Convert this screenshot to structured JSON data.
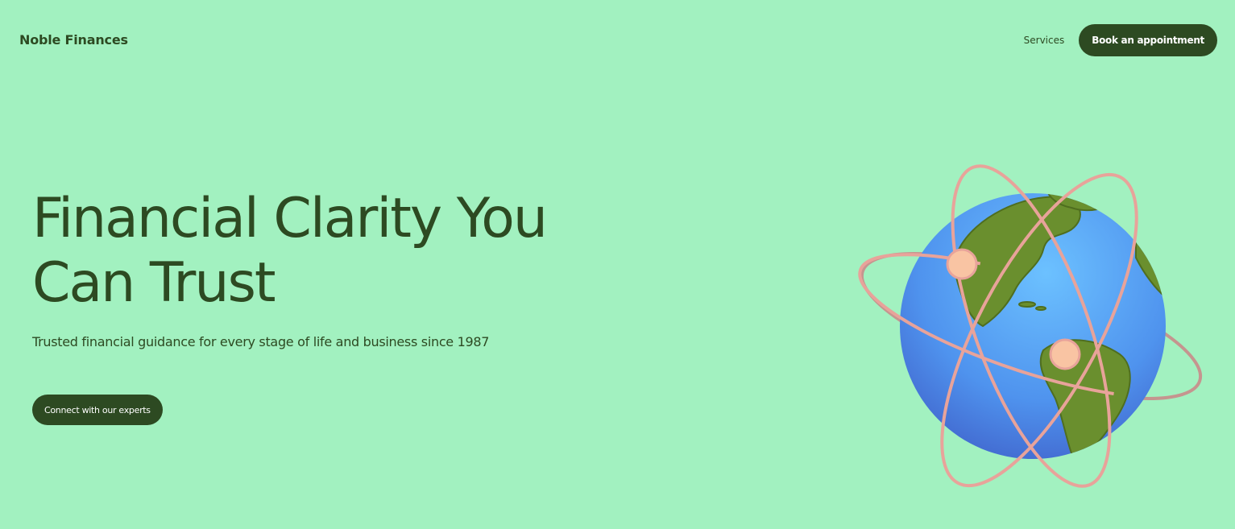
{
  "header": {
    "brand": "Noble Finances",
    "nav": {
      "services_label": "Services",
      "book_label": "Book an appointment"
    }
  },
  "hero": {
    "headline_line1": "Financial Clarity You",
    "headline_line2": "Can Trust",
    "subtitle": "Trusted financial guidance for every stage of life and business since 1987",
    "cta_label": "Connect with our experts"
  },
  "illustration": {
    "name": "globe-with-orbits-illustration"
  },
  "colors": {
    "background": "#a2f1c0",
    "primary": "#2d4a22",
    "button_text": "#ffffff",
    "ocean": "#4f9cf0",
    "land": "#6a8f2e",
    "orbit": "#e8a39a",
    "node": "#f9c4a3"
  }
}
